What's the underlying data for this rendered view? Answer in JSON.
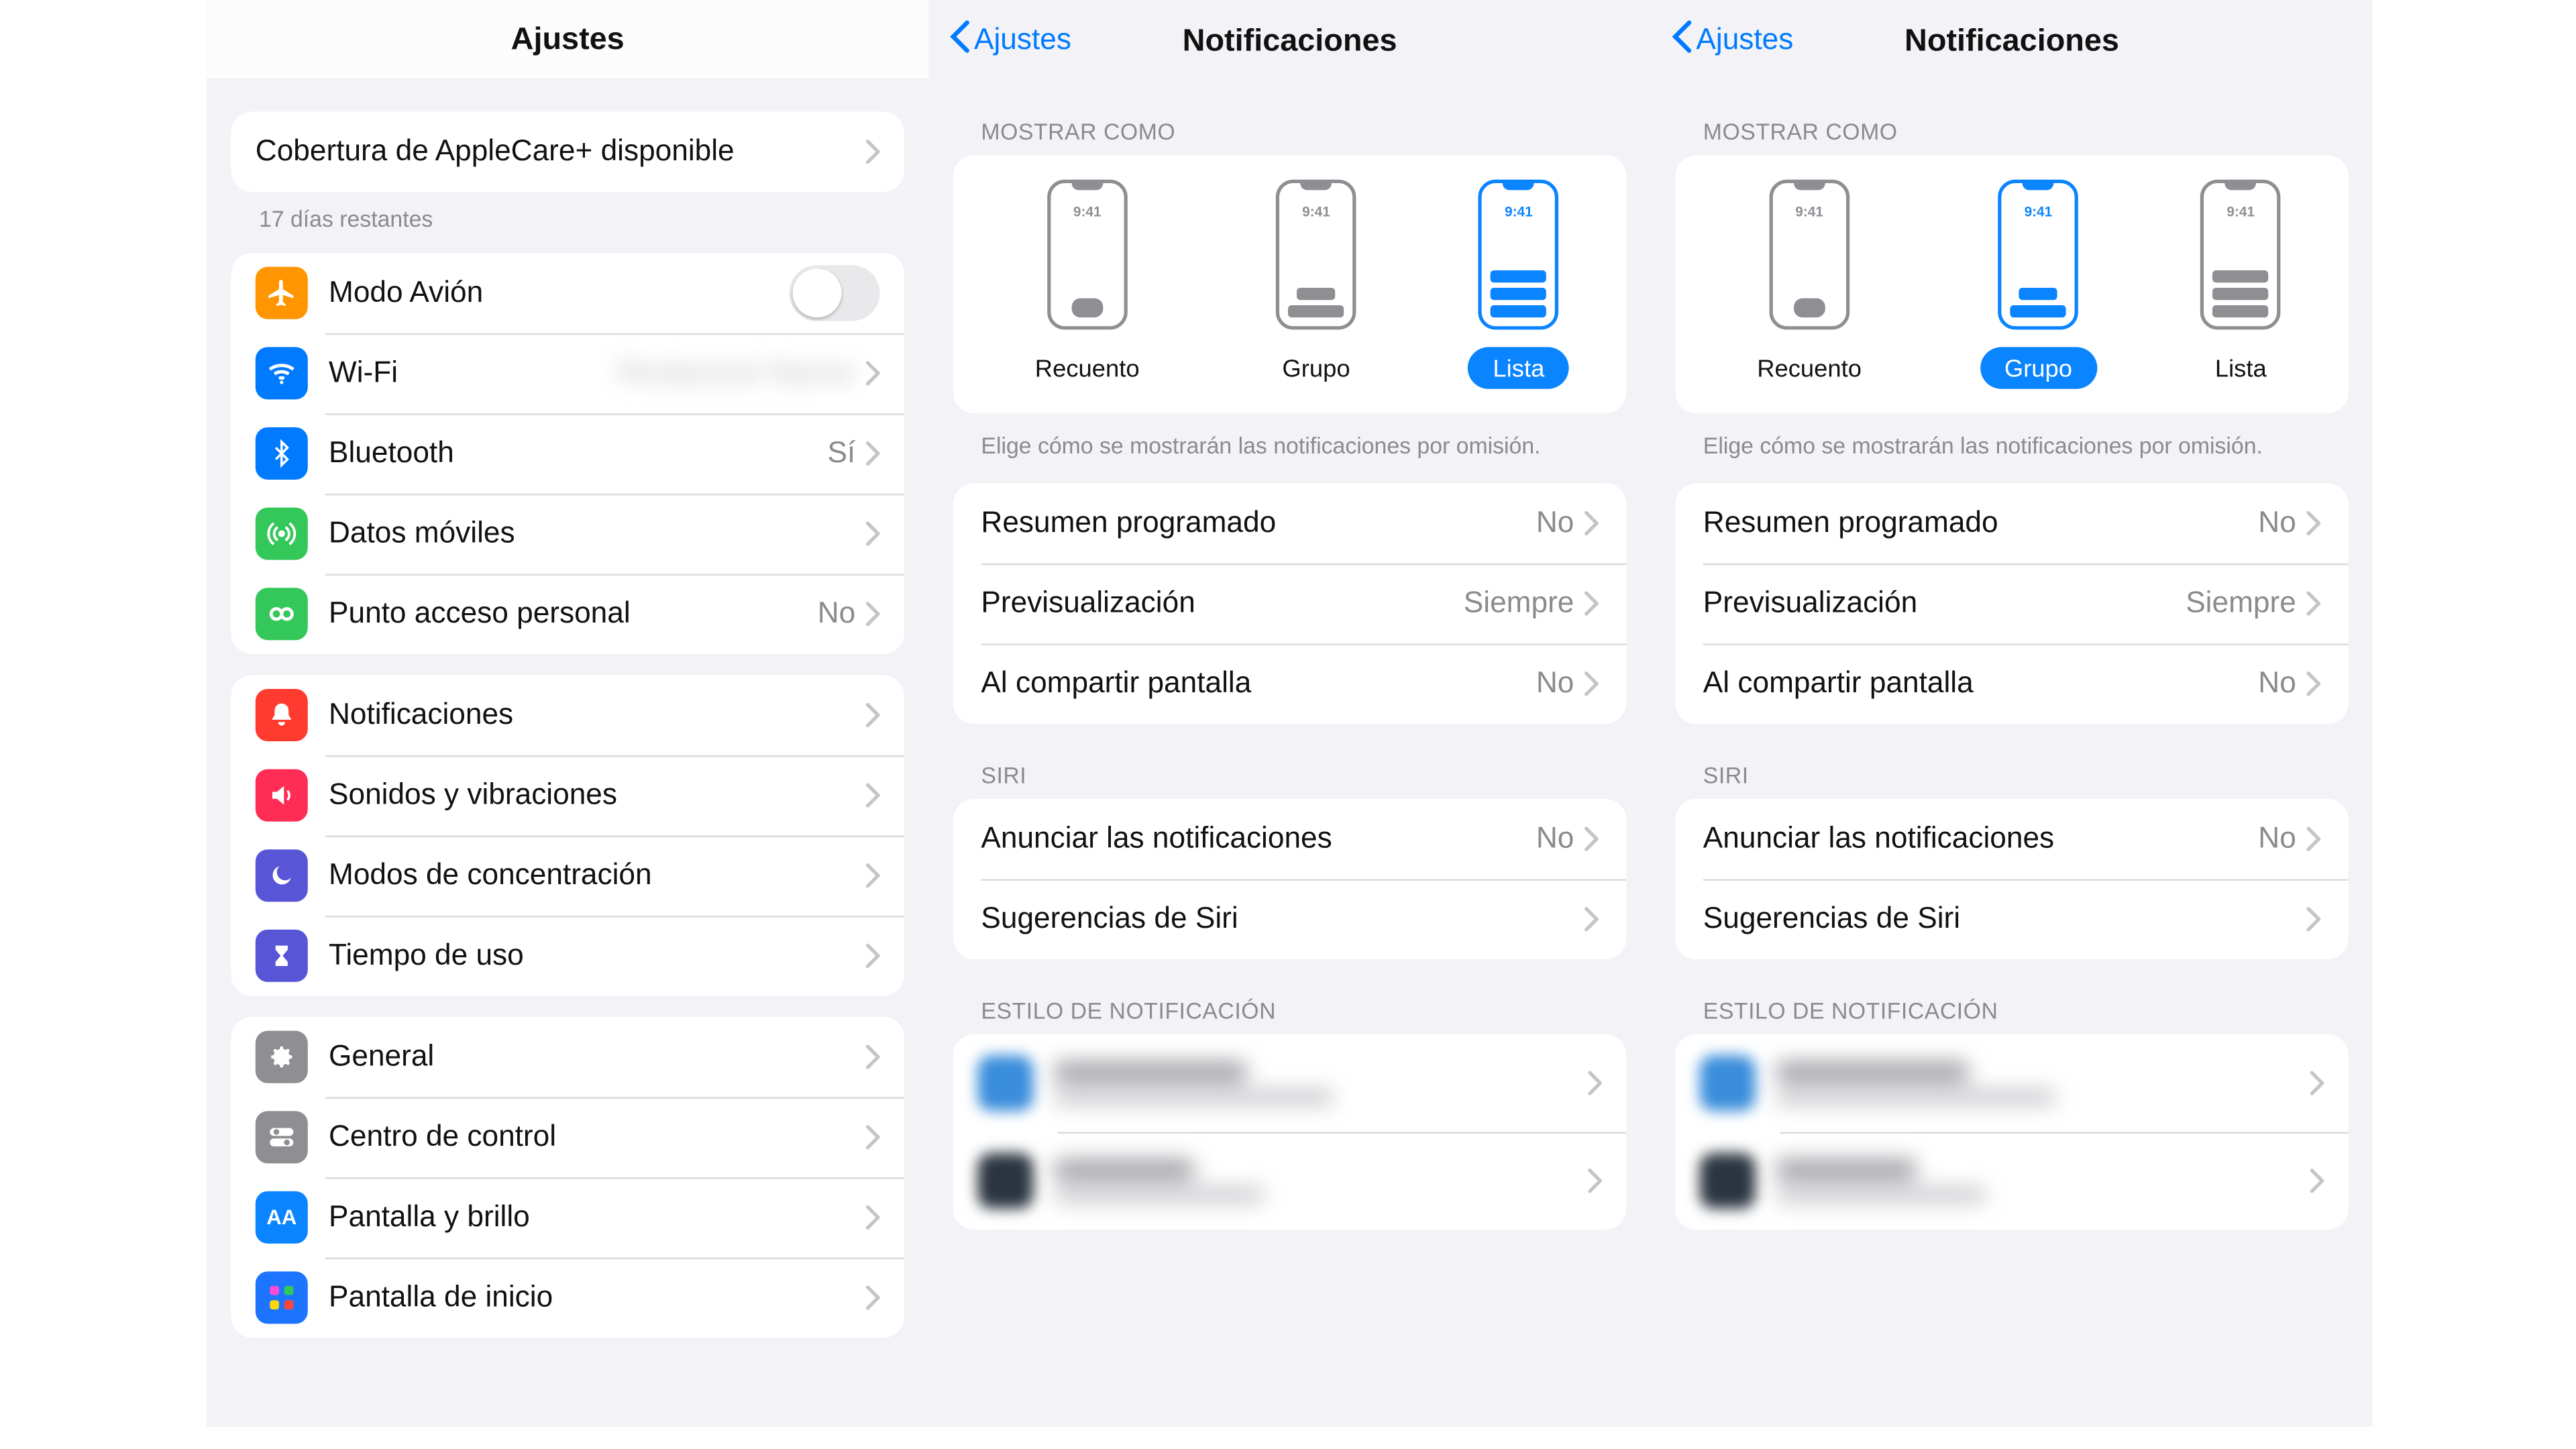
{
  "settings": {
    "title": "Ajustes",
    "coverage": "Cobertura de AppleCare+ disponible",
    "days_remaining": "17 días restantes",
    "wifi_value_blur": "Redacted Name",
    "connectivity": [
      {
        "label": "Modo Avión",
        "type": "toggle"
      },
      {
        "label": "Wi-Fi"
      },
      {
        "label": "Bluetooth",
        "value": "Sí"
      },
      {
        "label": "Datos móviles"
      },
      {
        "label": "Punto acceso personal",
        "value": "No"
      }
    ],
    "alerts": [
      {
        "label": "Notificaciones"
      },
      {
        "label": "Sonidos y vibraciones"
      },
      {
        "label": "Modos de concentración"
      },
      {
        "label": "Tiempo de uso"
      }
    ],
    "general": [
      {
        "label": "General"
      },
      {
        "label": "Centro de control"
      },
      {
        "label": "Pantalla y brillo"
      },
      {
        "label": "Pantalla de inicio"
      }
    ]
  },
  "notif": {
    "back": "Ajustes",
    "title": "Notificaciones",
    "show_as_header": "MOSTRAR COMO",
    "opts": {
      "count": "Recuento",
      "group": "Grupo",
      "list": "Lista",
      "time": "9:41"
    },
    "note": "Elige cómo se mostrarán las notificaciones por omisión.",
    "rows1": [
      {
        "label": "Resumen programado",
        "value": "No"
      },
      {
        "label": "Previsualización",
        "value": "Siempre"
      },
      {
        "label": "Al compartir pantalla",
        "value": "No"
      }
    ],
    "siri_header": "SIRI",
    "rows2": [
      {
        "label": "Anunciar las notificaciones",
        "value": "No"
      },
      {
        "label": "Sugerencias de Siri"
      }
    ],
    "style_header": "ESTILO DE NOTIFICACIÓN"
  },
  "left_selected": "list",
  "right_selected": "group"
}
